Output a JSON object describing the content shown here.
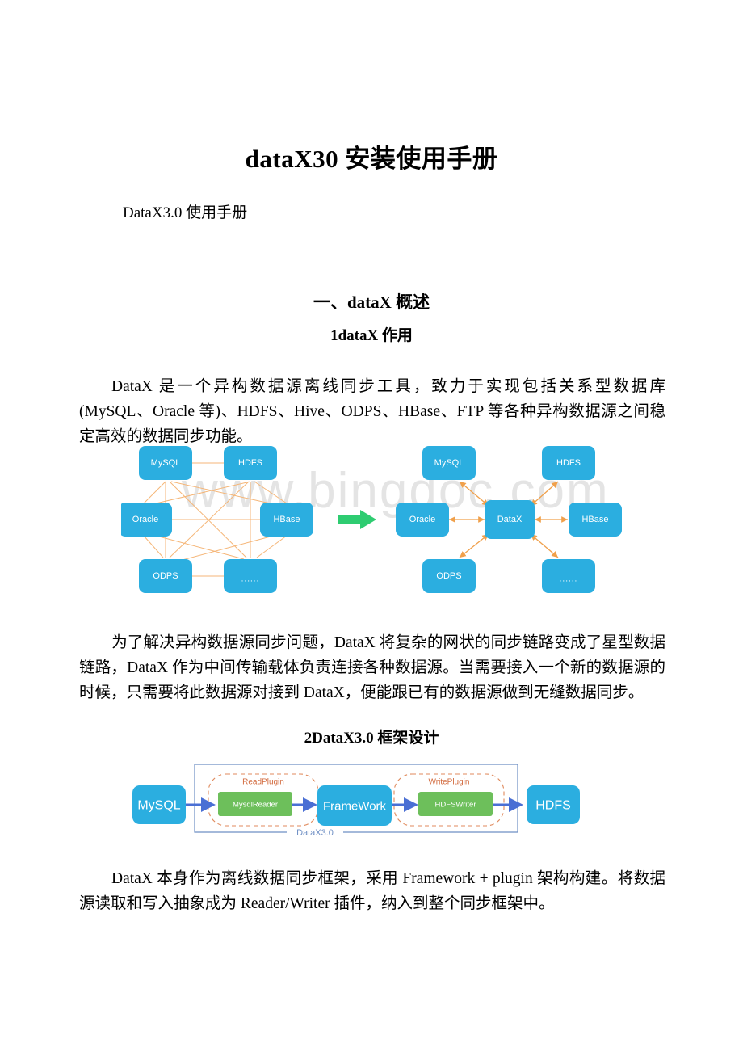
{
  "document": {
    "title": "dataX30 安装使用手册",
    "subtitle": "DataX3.0 使用手册",
    "section_heading": "一、dataX 概述",
    "subsection_1": "1dataX 作用",
    "subsection_2": "2DataX3.0 框架设计",
    "paragraph_intro": "DataX 是一个异构数据源离线同步工具，致力于实现包括关系型数据库(MySQL、Oracle 等)、HDFS、Hive、ODPS、HBase、FTP 等各种异构数据源之间稳定高效的数据同步功能。",
    "paragraph_star": "为了解决异构数据源同步问题，DataX 将复杂的网状的同步链路变成了星型数据链路，DataX 作为中间传输载体负责连接各种数据源。当需要接入一个新的数据源的时候，只需要将此数据源对接到 DataX，便能跟已有的数据源做到无缝数据同步。",
    "paragraph_framework": "DataX 本身作为离线数据同步框架，采用 Framework + plugin 架构构建。将数据源读取和写入抽象成为 Reader/Writer 插件，纳入到整个同步框架中。"
  },
  "watermark": {
    "text": "www.bingdoc.com"
  },
  "figure_mesh": {
    "nodes": {
      "mysql": "MySQL",
      "hdfs": "HDFS",
      "oracle": "Oracle",
      "hbase": "HBase",
      "odps": "ODPS",
      "other": "......"
    }
  },
  "figure_star": {
    "center": "DataX",
    "nodes": {
      "mysql": "MySQL",
      "hdfs": "HDFS",
      "oracle": "Oracle",
      "hbase": "HBase",
      "odps": "ODPS",
      "other": "......"
    }
  },
  "figure_framework": {
    "source": "MySQL",
    "read_plugin_label": "ReadPlugin",
    "reader": "MysqlReader",
    "core": "FrameWork",
    "write_plugin_label": "WritePlugin",
    "writer": "HDFSWriter",
    "target": "HDFS",
    "container_label": "DataX3.0"
  },
  "colors": {
    "node_blue": "#2BAEE0",
    "plugin_green": "#6DBF5B",
    "mesh_line_orange": "#F5B678",
    "arrow_orange": "#F0A04B",
    "flow_arrow_blue": "#4A6FD4",
    "transition_arrow_green": "#2ECC71",
    "dashed_orange": "#E08A5C",
    "container_border": "#6E8FC4",
    "watermark_gray": "#E4E4E4"
  }
}
